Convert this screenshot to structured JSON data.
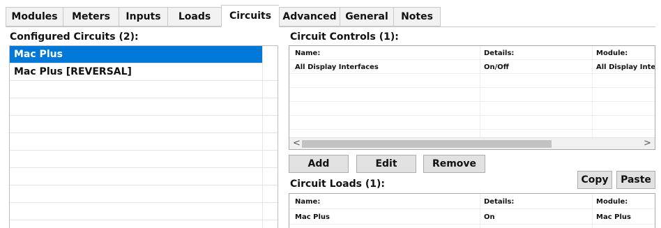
{
  "tabs": [
    {
      "label": "Modules",
      "active": false
    },
    {
      "label": "Meters",
      "active": false
    },
    {
      "label": "Inputs",
      "active": false
    },
    {
      "label": "Loads",
      "active": false
    },
    {
      "label": "Circuits",
      "active": true
    },
    {
      "label": "Advanced",
      "active": false
    },
    {
      "label": "General",
      "active": false
    },
    {
      "label": "Notes",
      "active": false
    }
  ],
  "configured_circuits": {
    "title": "Configured Circuits (2):",
    "items": [
      "Mac Plus",
      "Mac Plus [REVERSAL]"
    ],
    "selected_index": 0
  },
  "circuit_controls": {
    "title": "Circuit Controls (1):",
    "headers": [
      "Name:",
      "Details:",
      "Module:"
    ],
    "rows": [
      [
        "All Display Interfaces",
        "On/Off",
        "All Display Interfaces"
      ]
    ],
    "scroll_left": "<",
    "scroll_right": ">",
    "buttons": {
      "add": "Add",
      "edit": "Edit",
      "remove": "Remove"
    }
  },
  "clipboard": {
    "copy": "Copy",
    "paste": "Paste"
  },
  "circuit_loads": {
    "title": "Circuit Loads (1):",
    "headers": [
      "Name:",
      "Details:",
      "Module:"
    ],
    "rows": [
      [
        "Mac Plus",
        "On",
        "Mac Plus"
      ]
    ]
  },
  "colors": {
    "selection": "#0078d7",
    "selection_text": "#ffffff"
  }
}
